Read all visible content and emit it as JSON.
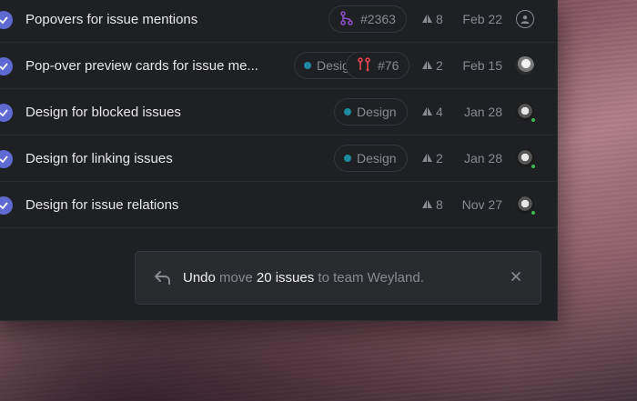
{
  "issues": [
    {
      "title": "Popovers for issue mentions",
      "pill_label": "#2363",
      "priority": "8",
      "date": "Feb 22",
      "avatar": "empty-avatar"
    },
    {
      "title": "Pop-over preview cards for issue me...",
      "pill_label": "Desig",
      "pill2_label": "#76",
      "priority": "2",
      "date": "Feb 15",
      "avatar": "user-avatar"
    },
    {
      "title": "Design for blocked issues",
      "pill_label": "Design",
      "priority": "4",
      "date": "Jan 28",
      "avatar": "user-avatar-online"
    },
    {
      "title": "Design for linking issues",
      "pill_label": "Design",
      "priority": "2",
      "date": "Jan 28",
      "avatar": "user-avatar-online"
    },
    {
      "title": "Design for issue relations",
      "priority": "8",
      "date": "Nov 27",
      "avatar": "user-avatar-online"
    }
  ],
  "toast": {
    "undo": "Undo",
    "text1": " move ",
    "count": "20 issues",
    "text2": " to team Weyland.",
    "icons": {
      "undo": "undo-arrow-icon",
      "close": "close-icon"
    }
  },
  "colors": {
    "check": "#5e6ad2",
    "label_dot": "#1d8aa0",
    "pr_purple": "#8b4ec7",
    "pr_red": "#e5484d",
    "online": "#3fb950"
  }
}
